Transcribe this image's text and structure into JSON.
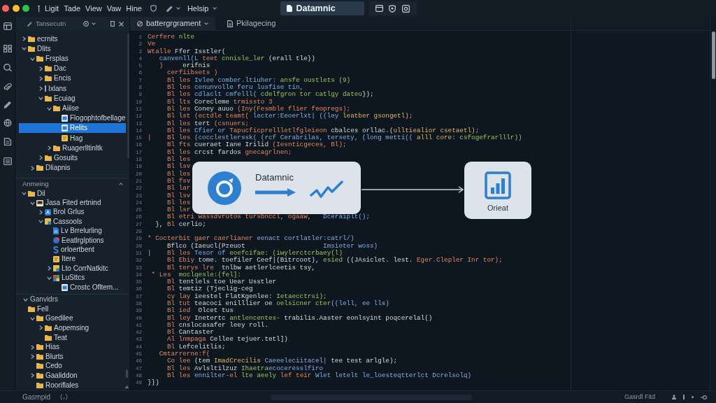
{
  "menu": [
    "Ligit",
    "Tade",
    "View",
    "Vaw",
    "Hine"
  ],
  "help_menu": {
    "label": "Helsip"
  },
  "title_tab": {
    "label": "Datamnic"
  },
  "sidebar": {
    "title": "Tansecutn",
    "tree": [
      {
        "label": "ecrnits",
        "kind": "folder",
        "expanded": false,
        "selected": false
      },
      {
        "label": "Dlits",
        "kind": "folder",
        "expanded": true,
        "selected": false,
        "children": [
          {
            "label": "Frsplas",
            "kind": "folder",
            "expanded": true,
            "selected": false,
            "children": [
              {
                "label": "Dac",
                "kind": "folder",
                "expanded": false,
                "selected": false
              },
              {
                "label": "Encis",
                "kind": "folder",
                "expanded": false,
                "selected": false
              },
              {
                "label": "Ixlans",
                "kind": "mark",
                "expanded": false,
                "selected": false
              },
              {
                "label": "Ecuiag",
                "kind": "folder",
                "expanded": true,
                "selected": false,
                "children": [
                  {
                    "label": "Aiiise",
                    "kind": "folder",
                    "expanded": true,
                    "selected": false,
                    "children": [
                      {
                        "label": "Flogophtofbellage",
                        "kind": "file",
                        "selected": false
                      },
                      {
                        "label": "Relits",
                        "kind": "file",
                        "selected": true
                      },
                      {
                        "label": "Hag",
                        "kind": "note",
                        "selected": false
                      }
                    ]
                  },
                  {
                    "label": "Ruagerlltinltk",
                    "kind": "folder",
                    "expanded": false,
                    "selected": false
                  }
                ]
              },
              {
                "label": "Gosuits",
                "kind": "folder",
                "expanded": false,
                "selected": false
              }
            ]
          },
          {
            "label": "Dliapnis",
            "kind": "folder",
            "expanded": false,
            "selected": false
          }
        ]
      }
    ],
    "sections": [
      {
        "title": "Anmeing",
        "kind": "panel",
        "items": [
          {
            "label": "Dil",
            "kind": "folder",
            "expanded": true,
            "selected": false,
            "children": [
              {
                "label": "Jasa Fited ertnind",
                "kind": "image",
                "expanded": true,
                "selected": false,
                "children": [
                  {
                    "label": "Brol Grlus",
                    "kind": "app",
                    "expanded": false,
                    "selected": false
                  },
                  {
                    "label": "Cassools",
                    "kind": "package",
                    "expanded": true,
                    "selected": false,
                    "children": [
                      {
                        "label": "Lv Brrelurling",
                        "kind": "doc",
                        "selected": false
                      },
                      {
                        "label": "Eeatlrglptions",
                        "kind": "badge",
                        "selected": false
                      },
                      {
                        "label": "orloertbent",
                        "kind": "script",
                        "selected": false
                      },
                      {
                        "label": "Itere",
                        "kind": "note",
                        "selected": false
                      },
                      {
                        "label": "Lto CorrNatkitc",
                        "kind": "package",
                        "expanded": false,
                        "selected": false
                      },
                      {
                        "label": "LuSttcs",
                        "kind": "palette",
                        "expanded": true,
                        "selected": false,
                        "children": [
                          {
                            "label": "Crostc Ofltem...",
                            "kind": "file",
                            "selected": false
                          }
                        ]
                      }
                    ]
                  }
                ]
              }
            ]
          }
        ]
      },
      {
        "title": "Ganvidrs",
        "kind": "group",
        "expanded": true,
        "items": [
          {
            "label": "Fell",
            "kind": "folder",
            "selected": false,
            "children": [
              {
                "label": "Gsedilee",
                "kind": "folder",
                "expanded": true,
                "selected": false,
                "children": [
                  {
                    "label": "Aopemsing",
                    "kind": "folder",
                    "expanded": false,
                    "selected": false
                  },
                  {
                    "label": "Teat",
                    "kind": "folder",
                    "selected": false
                  }
                ]
              },
              {
                "label": "Hias",
                "kind": "folder",
                "expanded": false,
                "selected": false
              },
              {
                "label": "Blurts",
                "kind": "folder",
                "expanded": false,
                "selected": false
              },
              {
                "label": "Cedo",
                "kind": "folder",
                "selected": false
              },
              {
                "label": "Gaaliddon",
                "kind": "folder",
                "expanded": false,
                "selected": false
              },
              {
                "label": "Rooriflales",
                "kind": "folder",
                "selected": false
              }
            ]
          }
        ]
      }
    ]
  },
  "editor": {
    "tabs": [
      {
        "label": "battergrgrament",
        "kind": "code",
        "selected": true
      },
      {
        "label": "Pkilagecing",
        "kind": "page",
        "selected": false
      }
    ],
    "lines": [
      {
        "num": "1",
        "tokens": [
          {
            "kind": "keyword",
            "text": "Cerfere "
          },
          {
            "kind": "string",
            "text": "nlte"
          }
        ]
      },
      {
        "num": "2",
        "tokens": [
          {
            "kind": "keyword",
            "text": "Ve"
          }
        ]
      },
      {
        "num": "3",
        "tokens": [
          {
            "kind": "keyword",
            "text": "Wtalle "
          },
          {
            "kind": "plain",
            "text": "Ffer Isstler("
          }
        ]
      },
      {
        "num": "4",
        "tokens": [
          {
            "kind": "name",
            "text": "   canvenll(L "
          },
          {
            "kind": "keyword",
            "text": "teet "
          },
          {
            "kind": "string",
            "text": "cnnisle_ler "
          },
          {
            "kind": "plain",
            "text": "(erall tle})"
          }
        ]
      },
      {
        "num": "5",
        "tokens": [
          {
            "kind": "keyword",
            "text": "   )     "
          },
          {
            "kind": "plain",
            "text": "erifnis"
          }
        ]
      },
      {
        "num": "6",
        "tokens": [
          {
            "kind": "keyword",
            "text": "     cerfiibsets )"
          }
        ]
      },
      {
        "num": "7",
        "tokens": [
          {
            "kind": "keyword",
            "text": "     Bl les "
          },
          {
            "kind": "name",
            "text": "Ivlee comber.ltiuher: "
          },
          {
            "kind": "string",
            "text": "ansfe oustlets (9)"
          }
        ]
      },
      {
        "num": "8",
        "tokens": [
          {
            "kind": "keyword",
            "text": "     Bl les "
          },
          {
            "kind": "name",
            "text": "cenunvolle feru lusfise tin,"
          }
        ]
      },
      {
        "num": "9",
        "tokens": [
          {
            "kind": "keyword",
            "text": "     Bl les "
          },
          {
            "kind": "name",
            "text": "cdlaclt cmfelll( "
          },
          {
            "kind": "string",
            "text": "cdelfgron tor catlgy dateu"
          },
          {
            "kind": "plain",
            "text": "});"
          }
        ]
      },
      {
        "num": "10",
        "tokens": [
          {
            "kind": "keyword",
            "text": "     Bl lts "
          },
          {
            "kind": "plain",
            "text": "Corecleme "
          },
          {
            "kind": "keyword",
            "text": "trmissto 3"
          }
        ]
      },
      {
        "num": "11",
        "tokens": [
          {
            "kind": "keyword",
            "text": "     Bl les "
          },
          {
            "kind": "plain",
            "text": "Coney auuo "
          },
          {
            "kind": "keyword",
            "text": "(Iny(Fesmble flier feopregs);"
          }
        ]
      },
      {
        "num": "12",
        "tokens": [
          {
            "kind": "keyword",
            "text": "     Bl lst (ectdle teamt( "
          },
          {
            "kind": "name",
            "text": "lecter:Eeoerlxt| ((ley "
          },
          {
            "kind": "number",
            "text": "leatber gsongetl);"
          }
        ]
      },
      {
        "num": "13",
        "tokens": [
          {
            "kind": "keyword",
            "text": "     Bl les "
          },
          {
            "kind": "plain",
            "text": "tert "
          },
          {
            "kind": "keyword",
            "text": "(csnuers;"
          }
        ]
      },
      {
        "num": "14",
        "tokens": [
          {
            "kind": "keyword",
            "text": "     Bl les "
          },
          {
            "kind": "name",
            "text": "Cfier or "
          },
          {
            "kind": "keyword",
            "text": "Tapucficprellletlfgleieon "
          },
          {
            "kind": "plain",
            "text": "cbalces orllac.("
          },
          {
            "kind": "number",
            "text": "ulltiealior csetaetl);"
          }
        ]
      },
      {
        "num": "15",
        "tokens": [
          {
            "kind": "keyword",
            "text": "|    Bl les "
          },
          {
            "kind": "name",
            "text": "(cocclestlerssk( (rcf Cerabrilas, tersety, (long metti(( "
          },
          {
            "kind": "number",
            "text": "alll core: "
          },
          {
            "kind": "string",
            "text": "csfogefrarlllr))"
          }
        ]
      },
      {
        "num": "16",
        "tokens": [
          {
            "kind": "keyword",
            "text": "     Bl fts "
          },
          {
            "kind": "plain",
            "text": "cueraet Iane Irilid "
          },
          {
            "kind": "keyword",
            "text": "(Iesnticgeces, Bl);"
          }
        ]
      },
      {
        "num": "17",
        "tokens": [
          {
            "kind": "keyword",
            "text": "     Bl les "
          },
          {
            "kind": "plain",
            "text": "crcst fardos "
          },
          {
            "kind": "keyword",
            "text": "gnecagrlnen;"
          }
        ]
      },
      {
        "num": "18",
        "tokens": [
          {
            "kind": "keyword",
            "text": "     Bl les"
          }
        ]
      },
      {
        "num": "19",
        "tokens": [
          {
            "kind": "keyword",
            "text": "     Bl lsv"
          }
        ]
      },
      {
        "num": "20",
        "tokens": [
          {
            "kind": "keyword",
            "text": "     Bl les"
          }
        ]
      },
      {
        "num": "21",
        "tokens": [
          {
            "kind": "keyword",
            "text": "     Bl fsv"
          }
        ]
      },
      {
        "num": "22",
        "tokens": [
          {
            "kind": "keyword",
            "text": "     Bl lar"
          }
        ]
      },
      {
        "num": "23",
        "tokens": [
          {
            "kind": "keyword",
            "text": "     Bl lsv"
          }
        ]
      },
      {
        "num": "24",
        "tokens": [
          {
            "kind": "keyword",
            "text": "     Bl les"
          }
        ]
      },
      {
        "num": "25",
        "tokens": [
          {
            "kind": "keyword",
            "text": "     Bl lsr"
          }
        ]
      },
      {
        "num": "26",
        "tokens": [
          {
            "kind": "keyword",
            "text": "     Bl etri wassdvrutos tursbnccl, ogaaw,   "
          },
          {
            "kind": "name",
            "text": "Dceraiplt();"
          }
        ]
      },
      {
        "num": "27",
        "tokens": [
          {
            "kind": "plain",
            "text": "  }, "
          },
          {
            "kind": "keyword",
            "text": "Bl "
          },
          {
            "kind": "plain",
            "text": "cerlio;"
          }
        ]
      },
      {
        "num": "28"
      },
      {
        "num": "29",
        "tokens": [
          {
            "kind": "keyword",
            "text": "* Cocterbit gaer caerlianer "
          },
          {
            "kind": "name",
            "text": "eenact cortlatler:catrl/)"
          }
        ]
      },
      {
        "num": "30",
        "tokens": [
          {
            "kind": "plain",
            "text": "     Bflco (Iaeucl(Pzeuot"
          },
          {
            "kind": "name",
            "text": "                    Imsieter woss)"
          }
        ]
      },
      {
        "num": "31",
        "tokens": [
          {
            "kind": "string",
            "text": "|"
          },
          {
            "kind": "keyword",
            "text": "    Bl les "
          },
          {
            "kind": "name",
            "text": "Tesor of "
          },
          {
            "kind": "string",
            "text": "eoefcifae: (iwylerctcrbaey(l)"
          }
        ]
      },
      {
        "num": "32",
        "tokens": [
          {
            "kind": "keyword",
            "text": "     Bl Ebiy "
          },
          {
            "kind": "plain",
            "text": "tome. toefiler Ceef|(Bitrcoot), "
          },
          {
            "kind": "string",
            "text": "esied "
          },
          {
            "kind": "plain",
            "text": "((JAsiclet. lest. "
          },
          {
            "kind": "keyword",
            "text": "Eger.Clepler Inr tor);"
          }
        ]
      },
      {
        "num": "33",
        "tokens": [
          {
            "kind": "keyword",
            "text": "     Bl terys lre  "
          },
          {
            "kind": "plain",
            "text": "tnlbw aetlerlceetis tsy,"
          }
        ]
      },
      {
        "num": "34",
        "tokens": [
          {
            "kind": "keyword",
            "text": " * Les  "
          },
          {
            "kind": "string",
            "text": "moclqesle:(fel]:"
          }
        ]
      },
      {
        "num": "35",
        "tokens": [
          {
            "kind": "keyword",
            "text": "     Bl "
          },
          {
            "kind": "plain",
            "text": "tentlels toe Uear Usstler"
          }
        ]
      },
      {
        "num": "36",
        "tokens": [
          {
            "kind": "keyword",
            "text": "     Bl "
          },
          {
            "kind": "plain",
            "text": "temtiz (Tjeclig-ceg"
          }
        ]
      },
      {
        "num": "37",
        "tokens": [
          {
            "kind": "keyword",
            "text": "     cy lay "
          },
          {
            "kind": "plain",
            "text": "ieestel FlatKgenlee: "
          },
          {
            "kind": "string",
            "text": "Ietaecctrsi);"
          }
        ]
      },
      {
        "num": "38",
        "tokens": [
          {
            "kind": "keyword",
            "text": "     Bl tut "
          },
          {
            "kind": "plain",
            "text": "teacoci enilllier oe "
          },
          {
            "kind": "string",
            "text": "oelsicner cter"
          },
          {
            "kind": "name",
            "text": "((lell, ee lls)"
          }
        ]
      },
      {
        "num": "39",
        "tokens": [
          {
            "kind": "keyword",
            "text": "     Bl ied  "
          },
          {
            "kind": "plain",
            "text": "Olcet tus"
          }
        ]
      },
      {
        "num": "40",
        "tokens": [
          {
            "kind": "keyword",
            "text": "     Bl ley "
          },
          {
            "kind": "plain",
            "text": "Inetertc "
          },
          {
            "kind": "string",
            "text": "antlencentes- "
          },
          {
            "kind": "plain",
            "text": "trabilis.Aaster eonlsyint poqcerelal()"
          }
        ]
      },
      {
        "num": "41",
        "tokens": [
          {
            "kind": "keyword",
            "text": "     Bl "
          },
          {
            "kind": "plain",
            "text": "cnslocasafer leey roll."
          }
        ]
      },
      {
        "num": "42",
        "tokens": [
          {
            "kind": "keyword",
            "text": "     Bl "
          },
          {
            "kind": "plain",
            "text": "Cantaster"
          }
        ]
      },
      {
        "num": "43",
        "tokens": [
          {
            "kind": "keyword",
            "text": "     Al lnmpaga "
          },
          {
            "kind": "plain",
            "text": "Cellee tejuer.tetl])"
          }
        ]
      },
      {
        "num": "44",
        "tokens": [
          {
            "kind": "keyword",
            "text": "     Bl "
          },
          {
            "kind": "plain",
            "text": "Lefcelitlis;"
          }
        ]
      },
      {
        "num": "45",
        "tokens": [
          {
            "kind": "keyword",
            "text": "   Cmtarrerne:f("
          }
        ]
      },
      {
        "num": "46",
        "tokens": [
          {
            "kind": "keyword",
            "text": "     Co lee "
          },
          {
            "kind": "plain",
            "text": "(tem "
          },
          {
            "kind": "number",
            "text": "ImadCrecilis "
          },
          {
            "kind": "name",
            "text": "Caeeeleciitacel| "
          },
          {
            "kind": "plain",
            "text": "tee test arlgle);"
          }
        ]
      },
      {
        "num": "47",
        "tokens": [
          {
            "kind": "keyword",
            "text": "     Bl les "
          },
          {
            "kind": "plain",
            "text": "Avlsltilzuz "
          },
          {
            "kind": "string",
            "text": "Ihaetra"
          },
          {
            "kind": "name",
            "text": "ecoceresslfiro"
          }
        ]
      },
      {
        "num": "48",
        "tokens": [
          {
            "kind": "keyword",
            "text": "     Bl les "
          },
          {
            "kind": "name",
            "text": "ennilter-"
          },
          {
            "kind": "keyword",
            "text": "el "
          },
          {
            "kind": "string",
            "text": "lte aeely "
          },
          {
            "kind": "keyword",
            "text": "lef teir "
          },
          {
            "kind": "name",
            "text": "Wlet letelt le_loesteqtterlct Dcrelsolq)"
          }
        ]
      },
      {
        "num": "49",
        "tokens": [
          {
            "kind": "plain",
            "text": "}})"
          }
        ]
      }
    ],
    "diagram": {
      "nodes": [
        {
          "kind": "pipeline",
          "label": "Datamnic"
        },
        {
          "kind": "chart",
          "label": "Orieat"
        }
      ]
    }
  },
  "status_bar": {
    "left": "Gasmpid",
    "right": "Gasrdl Fitd"
  }
}
